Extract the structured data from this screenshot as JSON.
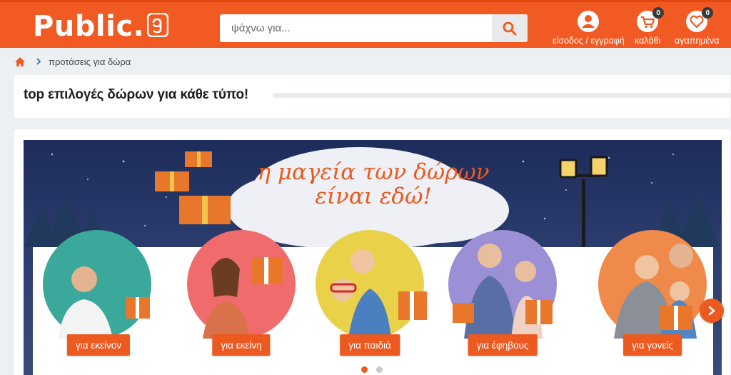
{
  "header": {
    "logo_text": "Public.",
    "search": {
      "placeholder": "ψάχνω για..."
    },
    "account_label": "είσοδος / εγγραφή",
    "cart_label": "καλάθι",
    "cart_count": "0",
    "wishlist_label": "αγαπημένα",
    "wishlist_count": "0"
  },
  "breadcrumb": {
    "current": "προτάσεις για δώρα"
  },
  "page_title": "top επιλογές δώρων για κάθε τύπο!",
  "banner": {
    "headline_line1": "η μαγεία των δώρων",
    "headline_line2": "είναι εδώ!",
    "categories": [
      {
        "label": "για εκείνον",
        "circle_color": "#3aa89a"
      },
      {
        "label": "για εκείνη",
        "circle_color": "#f06c6c"
      },
      {
        "label": "για παιδιά",
        "circle_color": "#e9d24a"
      },
      {
        "label": "για έφηβους",
        "circle_color": "#9b8fd6"
      },
      {
        "label": "για γονείς",
        "circle_color": "#f08a4b"
      }
    ]
  },
  "carousel": {
    "pages": 2,
    "active": 0
  },
  "colors": {
    "brand": "#f15a22",
    "accent": "#ec5a20"
  }
}
